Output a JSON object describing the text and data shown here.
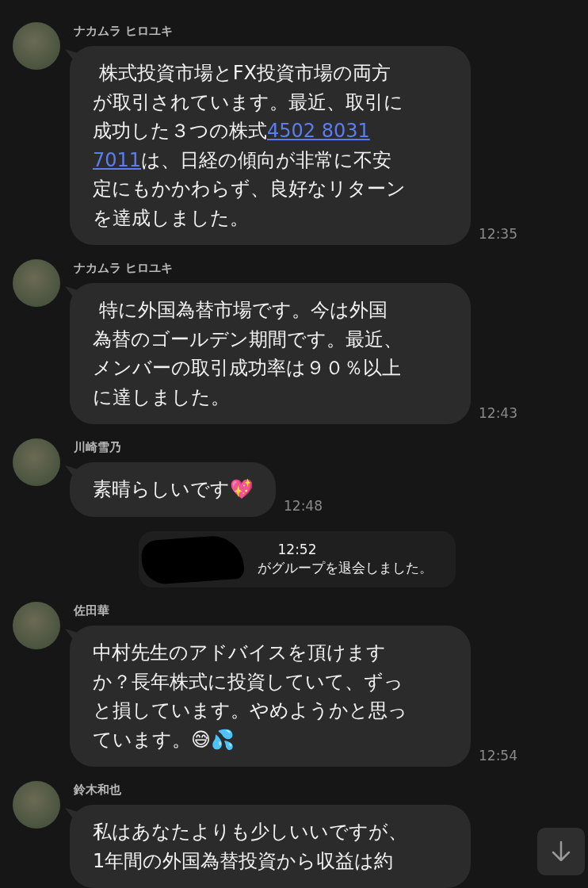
{
  "messages": [
    {
      "kind": "message",
      "sender": "ナカムラ ヒロユキ",
      "time": "12:35",
      "lines": [
        [
          {
            "kind": "text",
            "text": " 株式投資市場とFX投資市場の両方"
          }
        ],
        [
          {
            "kind": "text",
            "text": "が取引されています。最近、取引に"
          }
        ],
        [
          {
            "kind": "text",
            "text": "成功した３つの株式"
          },
          {
            "kind": "link",
            "text": "4502 8031"
          }
        ],
        [
          {
            "kind": "link",
            "text": "7011"
          },
          {
            "kind": "text",
            "text": "は、日経の傾向が非常に不安"
          }
        ],
        [
          {
            "kind": "text",
            "text": "定にもかかわらず、良好なリターン"
          }
        ],
        [
          {
            "kind": "text",
            "text": "を達成しました。"
          }
        ]
      ]
    },
    {
      "kind": "message",
      "sender": "ナカムラ ヒロユキ",
      "time": "12:43",
      "lines": [
        [
          {
            "kind": "text",
            "text": " 特に外国為替市場です。今は外国"
          }
        ],
        [
          {
            "kind": "text",
            "text": "為替のゴールデン期間です。最近、"
          }
        ],
        [
          {
            "kind": "text",
            "text": "メンバーの取引成功率は９０％以上"
          }
        ],
        [
          {
            "kind": "text",
            "text": "に達しました。"
          }
        ]
      ]
    },
    {
      "kind": "message",
      "sender": "川崎雪乃",
      "time": "12:48",
      "lines": [
        [
          {
            "kind": "text",
            "text": "素晴らしいです💖"
          }
        ]
      ]
    },
    {
      "kind": "system",
      "time": "12:52",
      "text": "がグループを退会しました。"
    },
    {
      "kind": "message",
      "sender": "佐田華",
      "time": "12:54",
      "lines": [
        [
          {
            "kind": "text",
            "text": "中村先生のアドバイスを頂けます"
          }
        ],
        [
          {
            "kind": "text",
            "text": "か？長年株式に投資していて、ずっ"
          }
        ],
        [
          {
            "kind": "text",
            "text": "と損しています。やめようかと思っ"
          }
        ],
        [
          {
            "kind": "text",
            "text": "ています。😅💦"
          }
        ]
      ]
    },
    {
      "kind": "message",
      "sender": "鈴木和也",
      "lines": [
        [
          {
            "kind": "text",
            "text": "私はあなたよりも少しいいですが、"
          }
        ],
        [
          {
            "kind": "text",
            "text": "1年間の外国為替投資から収益は約"
          }
        ]
      ]
    }
  ]
}
